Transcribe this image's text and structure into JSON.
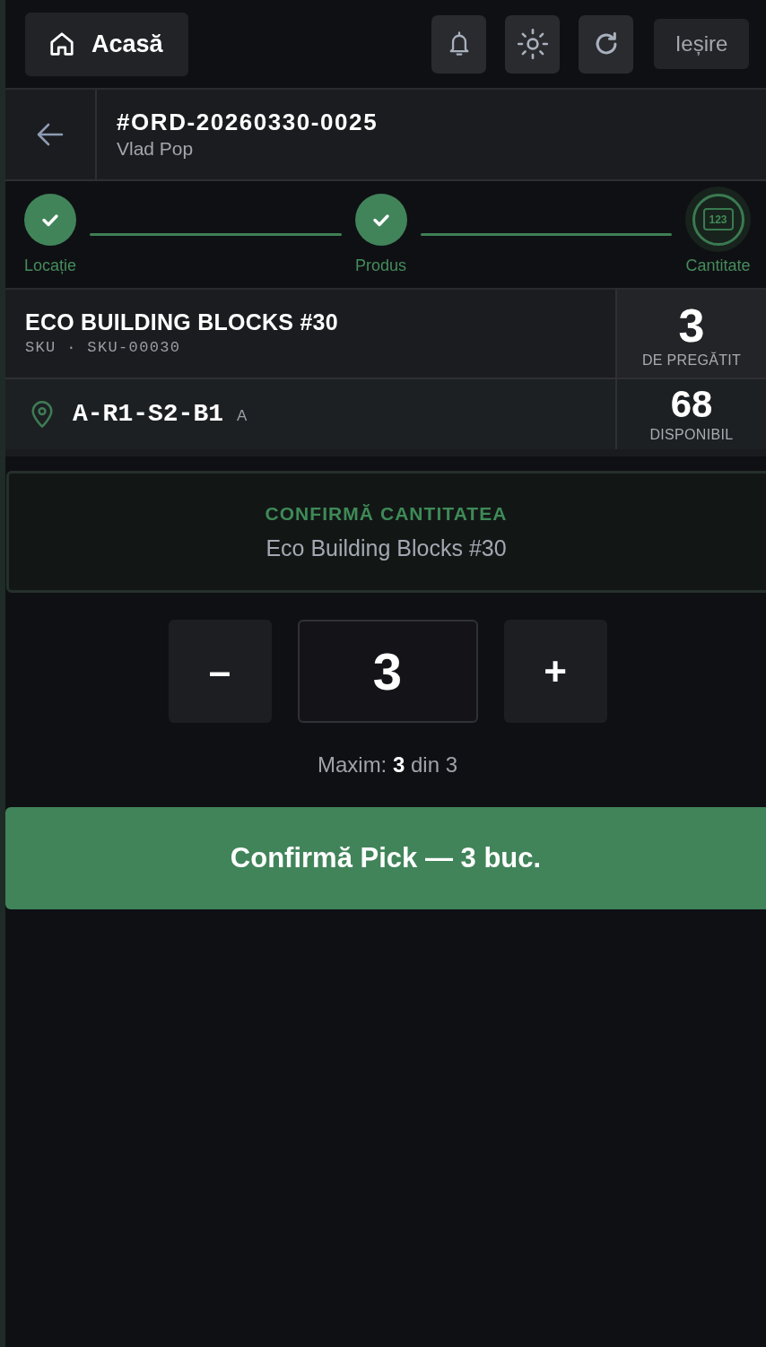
{
  "top_bar": {
    "home_button": {
      "label": "Acasă"
    },
    "logout_button": {
      "label": "Ieșire"
    }
  },
  "order_header": {
    "order_number": "#ORD-20260330-0025",
    "customer": "Vlad Pop"
  },
  "steps": [
    {
      "label": "Locație",
      "completed": true,
      "selected": false
    },
    {
      "label": "Produs",
      "completed": true,
      "selected": false
    },
    {
      "label": "Cantitate",
      "completed": false,
      "selected": true,
      "icon_text": "123"
    }
  ],
  "product": {
    "name": "ECO BUILDING BLOCKS #30",
    "sku": "SKU · SKU-00030",
    "to_pick": "3",
    "to_pick_label": "DE PREGĂTIT"
  },
  "location": {
    "code": "A-R1-S2-B1",
    "zone": "A",
    "available": "68",
    "available_label": "DISPONIBIL"
  },
  "confirm_card": {
    "title": "CONFIRMĂ CANTITATEA",
    "subtitle": "Eco Building Blocks #30"
  },
  "quantity": {
    "decrement": "–",
    "value": "3",
    "increment": "+",
    "max_text": "Maxim: **3** din 3"
  },
  "confirm_button": {
    "label": "Confirmă Pick — 3 buc."
  }
}
